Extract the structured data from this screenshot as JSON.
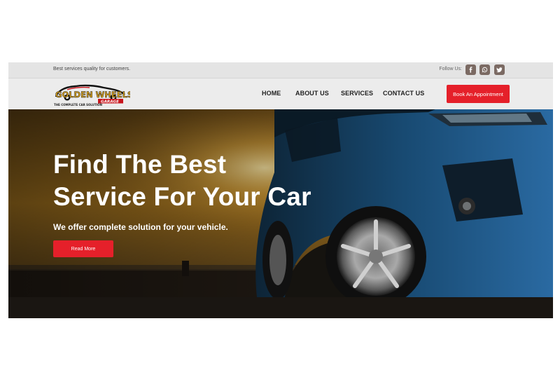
{
  "topbar": {
    "tagline": "Best services quality for customers.",
    "follow_label": "Follow Us:",
    "social": [
      {
        "icon": "facebook-icon"
      },
      {
        "icon": "whatsapp-icon"
      },
      {
        "icon": "twitter-icon"
      }
    ]
  },
  "brand": {
    "name": "GOLDEN WHEELS",
    "sub": "GARAGE",
    "tagline": "THE COMPLETE CAR SOLUTION"
  },
  "nav": {
    "items": [
      "HOME",
      "ABOUT US",
      "SERVICES",
      "CONTACT US"
    ],
    "cta": "Book An Appointment"
  },
  "hero": {
    "title_line1": "Find The Best",
    "title_line2": "Service For Your Car",
    "subtitle": "We offer complete solution for your vehicle.",
    "button": "Read More"
  },
  "colors": {
    "accent": "#e5202a",
    "header_bg": "#ececec",
    "topbar_bg": "#e4e4e4",
    "social_bg": "#7b6a63"
  }
}
